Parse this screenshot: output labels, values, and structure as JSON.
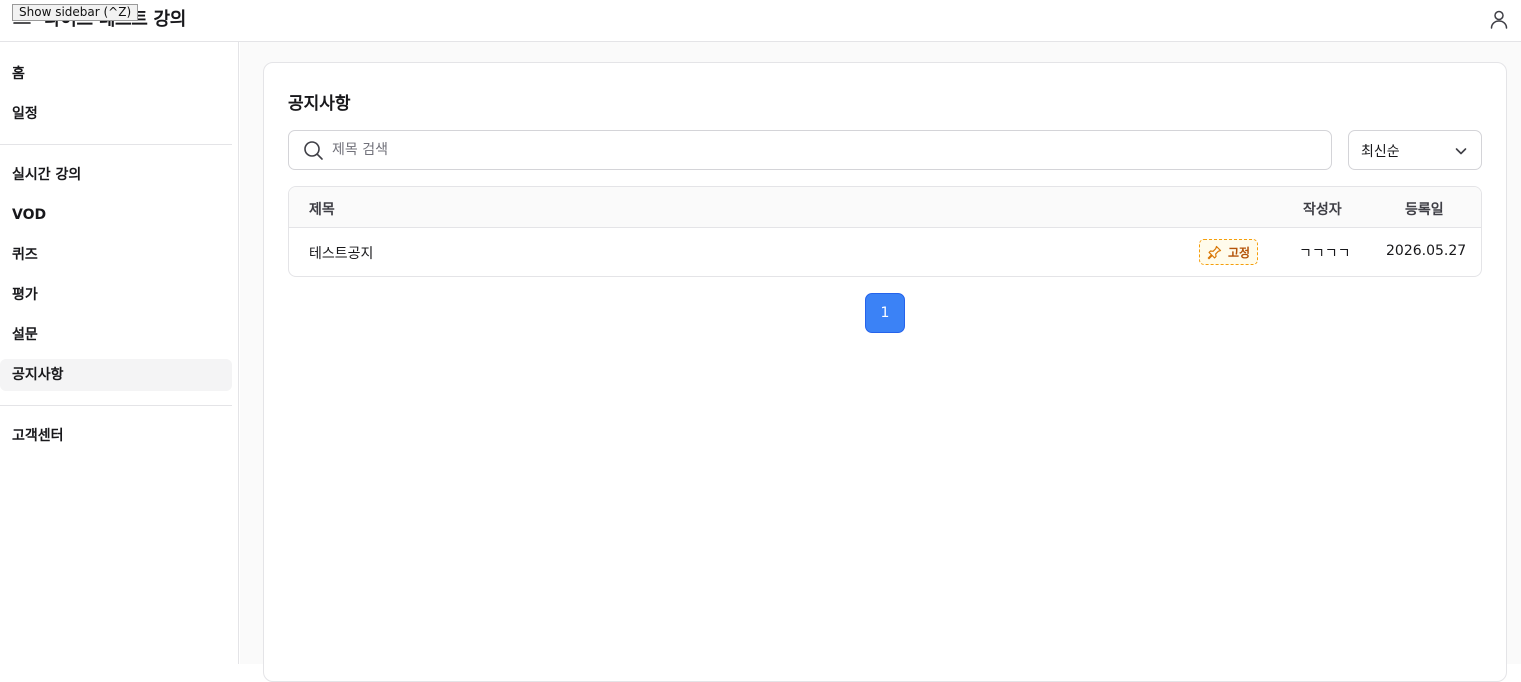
{
  "tooltip": "Show sidebar (^Z)",
  "app": {
    "title": "라이브 테스트 강의"
  },
  "sidebar": {
    "items": [
      {
        "label": "홈"
      },
      {
        "label": "일정"
      },
      {
        "label": "실시간 강의"
      },
      {
        "label": "VOD"
      },
      {
        "label": "퀴즈"
      },
      {
        "label": "평가"
      },
      {
        "label": "설문"
      },
      {
        "label": "공지사항",
        "active": true
      },
      {
        "label": "고객센터"
      }
    ]
  },
  "page": {
    "title": "공지사항"
  },
  "search": {
    "placeholder": "제목 검색",
    "value": ""
  },
  "sort": {
    "selected": "최신순"
  },
  "table": {
    "headers": {
      "title": "제목",
      "author": "작성자",
      "date": "등록일"
    },
    "rows": [
      {
        "title": "테스트공지",
        "badge": "고정",
        "author": "ㄱㄱㄱㄱ",
        "date": "2026.05.27"
      }
    ]
  },
  "pagination": {
    "current": "1"
  },
  "icons": {
    "menu": "menu-icon",
    "user": "user-icon",
    "search": "search-icon",
    "chevron": "chevron-down-icon",
    "pin": "pin-icon"
  },
  "colors": {
    "accent": "#3b82f6",
    "pin_border": "#f59e0b",
    "pin_text": "#b45309",
    "active_bg": "#f4f4f5"
  }
}
